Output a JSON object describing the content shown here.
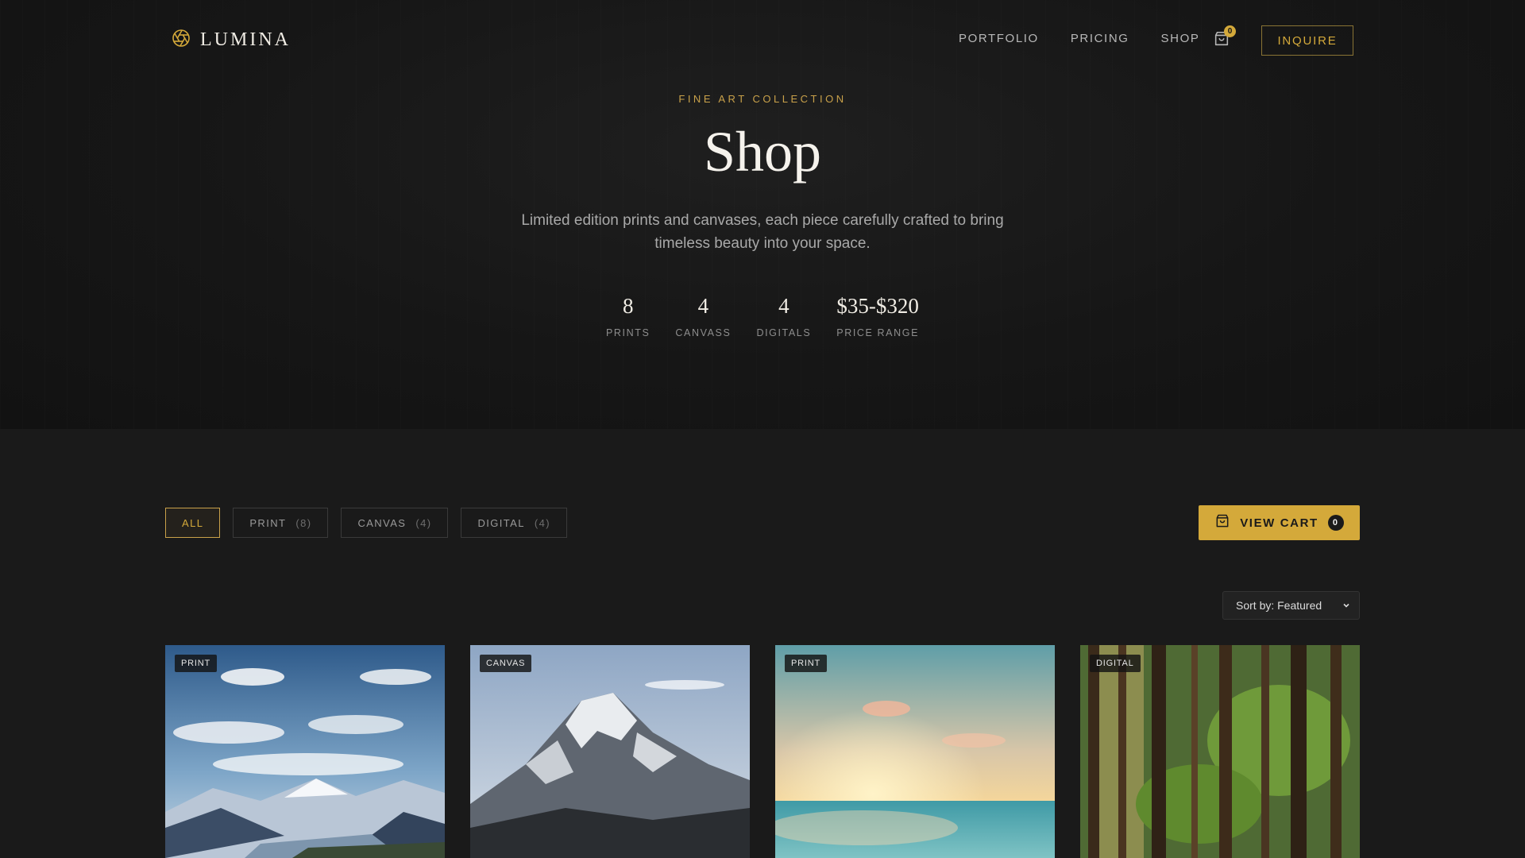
{
  "brand": {
    "name": "LUMINA",
    "logo_icon": "aperture-icon",
    "accent": "#d4a93a"
  },
  "nav": {
    "links": [
      "PORTFOLIO",
      "PRICING",
      "SHOP"
    ],
    "cart_count": "0",
    "inquire_label": "INQUIRE"
  },
  "hero": {
    "eyebrow": "FINE ART COLLECTION",
    "title": "Shop",
    "subtitle": "Limited edition prints and canvases, each piece carefully crafted to bring timeless beauty into your space.",
    "stats": [
      {
        "value": "8",
        "label": "PRINTS"
      },
      {
        "value": "4",
        "label": "CANVASS"
      },
      {
        "value": "4",
        "label": "DIGITALS"
      },
      {
        "value": "$35-$320",
        "label": "PRICE RANGE"
      }
    ]
  },
  "filters": [
    {
      "label": "ALL",
      "count": "",
      "active": true
    },
    {
      "label": "PRINT",
      "count": "(8)",
      "active": false
    },
    {
      "label": "CANVAS",
      "count": "(4)",
      "active": false
    },
    {
      "label": "DIGITAL",
      "count": "(4)",
      "active": false
    }
  ],
  "cart_button": {
    "label": "VIEW CART",
    "count": "0"
  },
  "sort": {
    "label": "Sort by: Featured"
  },
  "products": [
    {
      "tag": "PRINT",
      "scene": "alpine-valley"
    },
    {
      "tag": "CANVAS",
      "scene": "snowy-peak"
    },
    {
      "tag": "PRINT",
      "scene": "ocean-sunset"
    },
    {
      "tag": "DIGITAL",
      "scene": "forest"
    }
  ]
}
